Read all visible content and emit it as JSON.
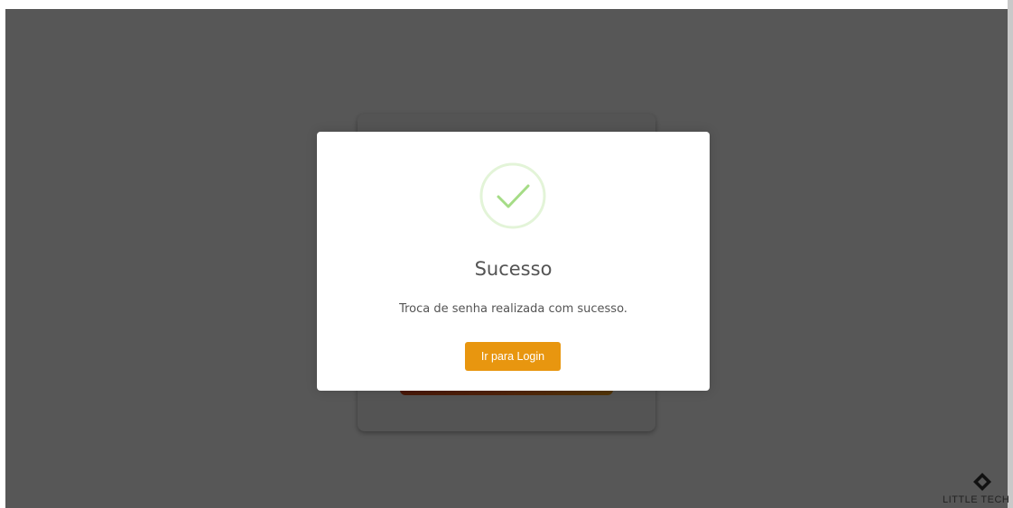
{
  "modal": {
    "icon": "checkmark-circle-icon",
    "title": "Sucesso",
    "message": "Troca de senha realizada com sucesso.",
    "confirm_label": "Ir para Login"
  },
  "branding": {
    "logo_icon": "diamond-logo-icon",
    "logo_text": "LITTLE TECH"
  },
  "colors": {
    "overlay": "#555555",
    "confirm_button": "#e8960f",
    "success": "#a5dc86",
    "background_button_gradient": [
      "#d4471a",
      "#ec9a17"
    ]
  }
}
